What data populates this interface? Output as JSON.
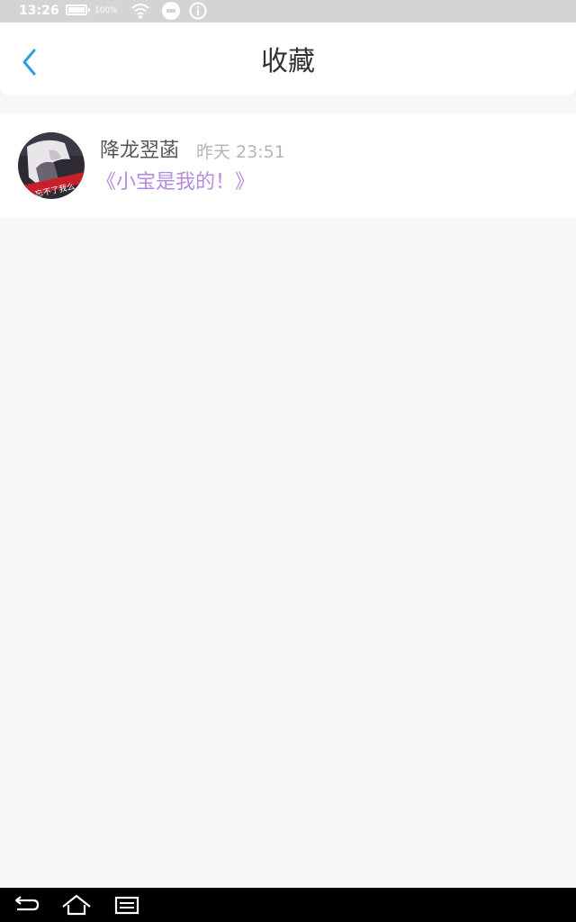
{
  "status_bar": {
    "time": "13:26",
    "battery_percent": "100%",
    "battery_level": 1.0,
    "icons": [
      "battery-icon",
      "wifi-icon",
      "do-not-disturb-icon",
      "info-icon"
    ]
  },
  "header": {
    "title": "收藏",
    "back_icon": "chevron-left-icon",
    "accent_color": "#2a9fe0"
  },
  "favorites": [
    {
      "author": "降龙翌菡",
      "time": "昨天 23:51",
      "title": "《小宝是我的！》",
      "avatar": "avatar-image",
      "title_color": "#b58ae0"
    }
  ],
  "nav_bar": {
    "icons": [
      "back-icon",
      "home-icon",
      "recent-apps-icon"
    ]
  }
}
